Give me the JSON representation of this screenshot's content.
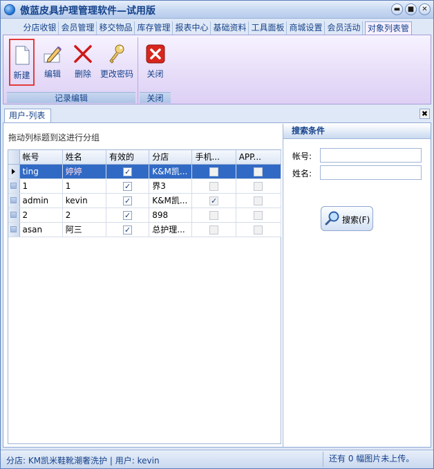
{
  "window": {
    "title": "傲蓝皮具护理管理软件—试用版",
    "minimize": "▬",
    "maximize": "■",
    "close": "✕"
  },
  "menu_tabs": [
    "分店收银",
    "会员管理",
    "移交物品",
    "库存管理",
    "报表中心",
    "基础资料",
    "工具面板",
    "商城设置",
    "会员活动",
    "对象列表管"
  ],
  "ribbon": {
    "groups": [
      {
        "label": "记录编辑",
        "buttons": [
          {
            "label": "新建",
            "icon": "new-document-icon"
          },
          {
            "label": "编辑",
            "icon": "pencil-edit-icon"
          },
          {
            "label": "删除",
            "icon": "delete-x-icon"
          },
          {
            "label": "更改密码",
            "icon": "keys-icon"
          }
        ]
      },
      {
        "label": "关闭",
        "buttons": [
          {
            "label": "关闭",
            "icon": "close-red-icon"
          }
        ]
      }
    ]
  },
  "panel": {
    "tab": "用户-列表",
    "group_hint": "拖动列标题到这进行分组",
    "close_icon": "✖"
  },
  "grid": {
    "columns": [
      "帐号",
      "姓名",
      "有效的",
      "分店",
      "手机...",
      "APP..."
    ],
    "rows": [
      {
        "account": "ting",
        "name": "婷婷",
        "valid": true,
        "branch": "K&M凯...",
        "mobile": false,
        "app": false,
        "selected": true
      },
      {
        "account": "1",
        "name": "1",
        "valid": true,
        "branch": "界3",
        "mobile": false,
        "app": false,
        "selected": false
      },
      {
        "account": "admin",
        "name": "kevin",
        "valid": true,
        "branch": "K&M凯...",
        "mobile": true,
        "app": false,
        "selected": false
      },
      {
        "account": "2",
        "name": "2",
        "valid": true,
        "branch": "898",
        "mobile": false,
        "app": false,
        "selected": false
      },
      {
        "account": "asan",
        "name": "阿三",
        "valid": true,
        "branch": "总护理...",
        "mobile": false,
        "app": false,
        "selected": false
      }
    ]
  },
  "search": {
    "title": "搜索条件",
    "account_label": "帐号:",
    "account_value": "",
    "name_label": "姓名:",
    "name_value": "",
    "button_label": "搜索(F)"
  },
  "status": {
    "left": "分店: KM凯米鞋靴潮奢洗护  | 用户: kevin",
    "right": "还有 0 幅图片未上传。"
  },
  "colors": {
    "selection": "#316ac5",
    "accent": "#15428b",
    "highlight_border": "#e33b3b"
  }
}
